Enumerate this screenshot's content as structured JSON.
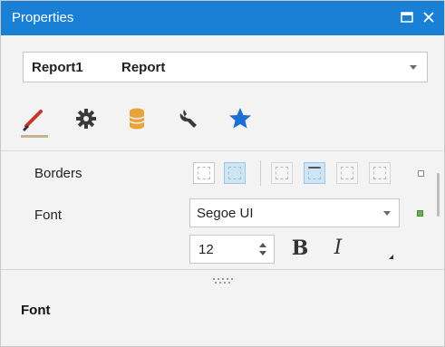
{
  "window": {
    "title": "Properties"
  },
  "object_selector": {
    "name": "Report1",
    "type": "Report"
  },
  "tabs": [
    {
      "icon": "brush-icon",
      "label": "Appearance",
      "selected": true
    },
    {
      "icon": "gear-icon",
      "label": "Behavior",
      "selected": false
    },
    {
      "icon": "database-icon",
      "label": "Data",
      "selected": false
    },
    {
      "icon": "wrench-icon",
      "label": "Design",
      "selected": false
    },
    {
      "icon": "star-icon",
      "label": "Favorites",
      "selected": false
    }
  ],
  "properties": {
    "borders": {
      "label": "Borders",
      "buttons": [
        {
          "name": "border-all",
          "active": false
        },
        {
          "name": "border-none",
          "active": true
        },
        {
          "name": "border-left",
          "active": false
        },
        {
          "name": "border-top",
          "active": true
        },
        {
          "name": "border-right",
          "active": false
        },
        {
          "name": "border-bottom",
          "active": false
        }
      ]
    },
    "font": {
      "label": "Font",
      "family": "Segoe UI",
      "size": "12",
      "bold_label": "B",
      "italic_label": "I"
    }
  },
  "description": {
    "title": "Font"
  },
  "colors": {
    "titlebar": "#1a80d6",
    "active_button": "#cde6f7",
    "modified_marker": "#6ab04c",
    "star": "#1a6fd1",
    "database": "#e8a33c"
  }
}
